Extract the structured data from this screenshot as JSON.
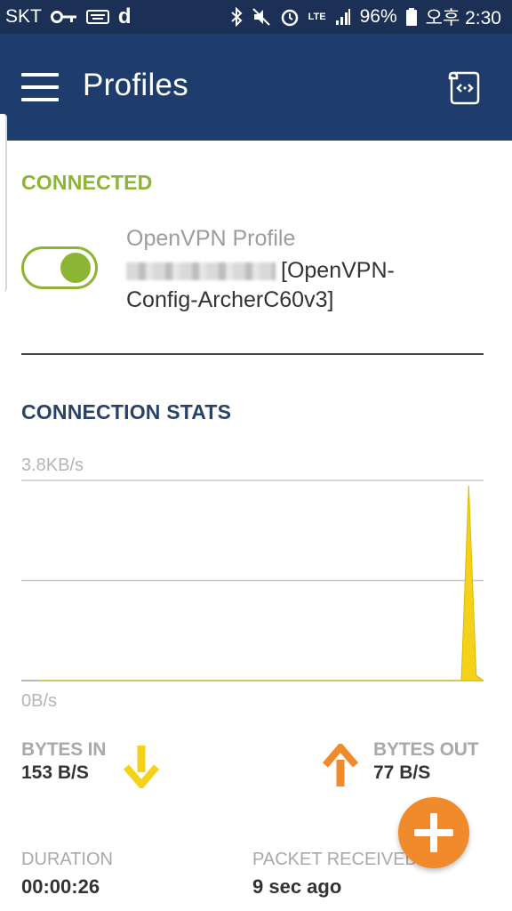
{
  "status_bar": {
    "carrier": "SKT",
    "key_icon": "key-icon",
    "keyboard_icon": "keyboard-icon",
    "app_icon": "d",
    "network": "LTE",
    "battery": "96%",
    "time": "오후 2:30"
  },
  "app_bar": {
    "title": "Profiles",
    "menu_icon": "hamburger-menu-icon",
    "import_icon": "import-file-icon"
  },
  "connection": {
    "section_title": "CONNECTED",
    "toggle_on": true,
    "profile_type": "OpenVPN Profile",
    "profile_name_line1": "[OpenVPN-",
    "profile_name_line2": "Config-ArcherC60v3]"
  },
  "stats": {
    "section_title": "CONNECTION STATS",
    "max_label": "3.8KB/s",
    "min_label": "0B/s",
    "bytes_in_label": "BYTES IN",
    "bytes_in_value": "153 B/S",
    "bytes_out_label": "BYTES OUT",
    "bytes_out_value": "77 B/S",
    "duration_label": "DURATION",
    "duration_value": "00:00:26",
    "packet_label": "PACKET RECEIVED",
    "packet_value": "9 sec ago"
  },
  "colors": {
    "status_bar": "#1c2f55",
    "app_bar": "#1f3d6c",
    "connected_green": "#8cb534",
    "bytes_in_yellow": "#f5d21a",
    "bytes_out_orange": "#f08a2a",
    "fab_orange": "#f08a2a"
  },
  "chart_data": {
    "type": "area",
    "title": "",
    "xlabel": "",
    "ylabel": "",
    "ylim_labels": [
      "0B/s",
      "3.8KB/s"
    ],
    "series": [
      {
        "name": "BYTES IN",
        "values": [
          0,
          0,
          0,
          0,
          0,
          0,
          0,
          0,
          0,
          0,
          0,
          0,
          0,
          0,
          0,
          0,
          0,
          0,
          0,
          0,
          0,
          0,
          0,
          0,
          0,
          0,
          0,
          0,
          0,
          0,
          0,
          0,
          0,
          0,
          0,
          0,
          0,
          0,
          0,
          0,
          0,
          0,
          0,
          0,
          0,
          0,
          0,
          0,
          0,
          0,
          0,
          0,
          0,
          0,
          0,
          0,
          0,
          0,
          3.8,
          0.1,
          0
        ],
        "unit": "KB/s"
      }
    ]
  },
  "fab": {
    "icon": "plus-icon"
  }
}
